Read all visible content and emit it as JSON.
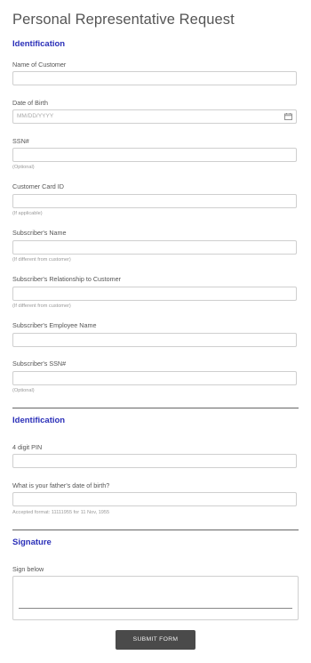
{
  "form": {
    "title": "Personal Representative Request",
    "section_identification_1": "Identification",
    "section_identification_2": "Identification",
    "section_signature": "Signature",
    "fields": {
      "name_of_customer": {
        "label": "Name of Customer",
        "value": ""
      },
      "date_of_birth": {
        "label": "Date of Birth",
        "placeholder": "MM/DD/YYYY",
        "icon": "calendar-icon"
      },
      "ssn": {
        "label": "SSN#",
        "hint": "(Optional)"
      },
      "customer_card_id": {
        "label": "Customer Card ID",
        "hint": "(If applicable)"
      },
      "subscribers_name": {
        "label": "Subscriber's Name",
        "hint": "(If different from customer)"
      },
      "subscribers_relationship": {
        "label": "Subscriber's Relationship to Customer",
        "hint": "(If different from customer)"
      },
      "subscribers_employee_name": {
        "label": "Subscriber's Employee Name"
      },
      "subscribers_ssn": {
        "label": "Subscriber's SSN#",
        "hint": "(Optional)"
      },
      "pin": {
        "label": "4 digit PIN"
      },
      "fathers_dob": {
        "label": "What is your father's date of birth?",
        "hint": "Accepted format: 11111955 for 11 Nov, 1955"
      },
      "signature": {
        "label": "Sign below"
      }
    },
    "submit_label": "SUBMIT FORM"
  }
}
